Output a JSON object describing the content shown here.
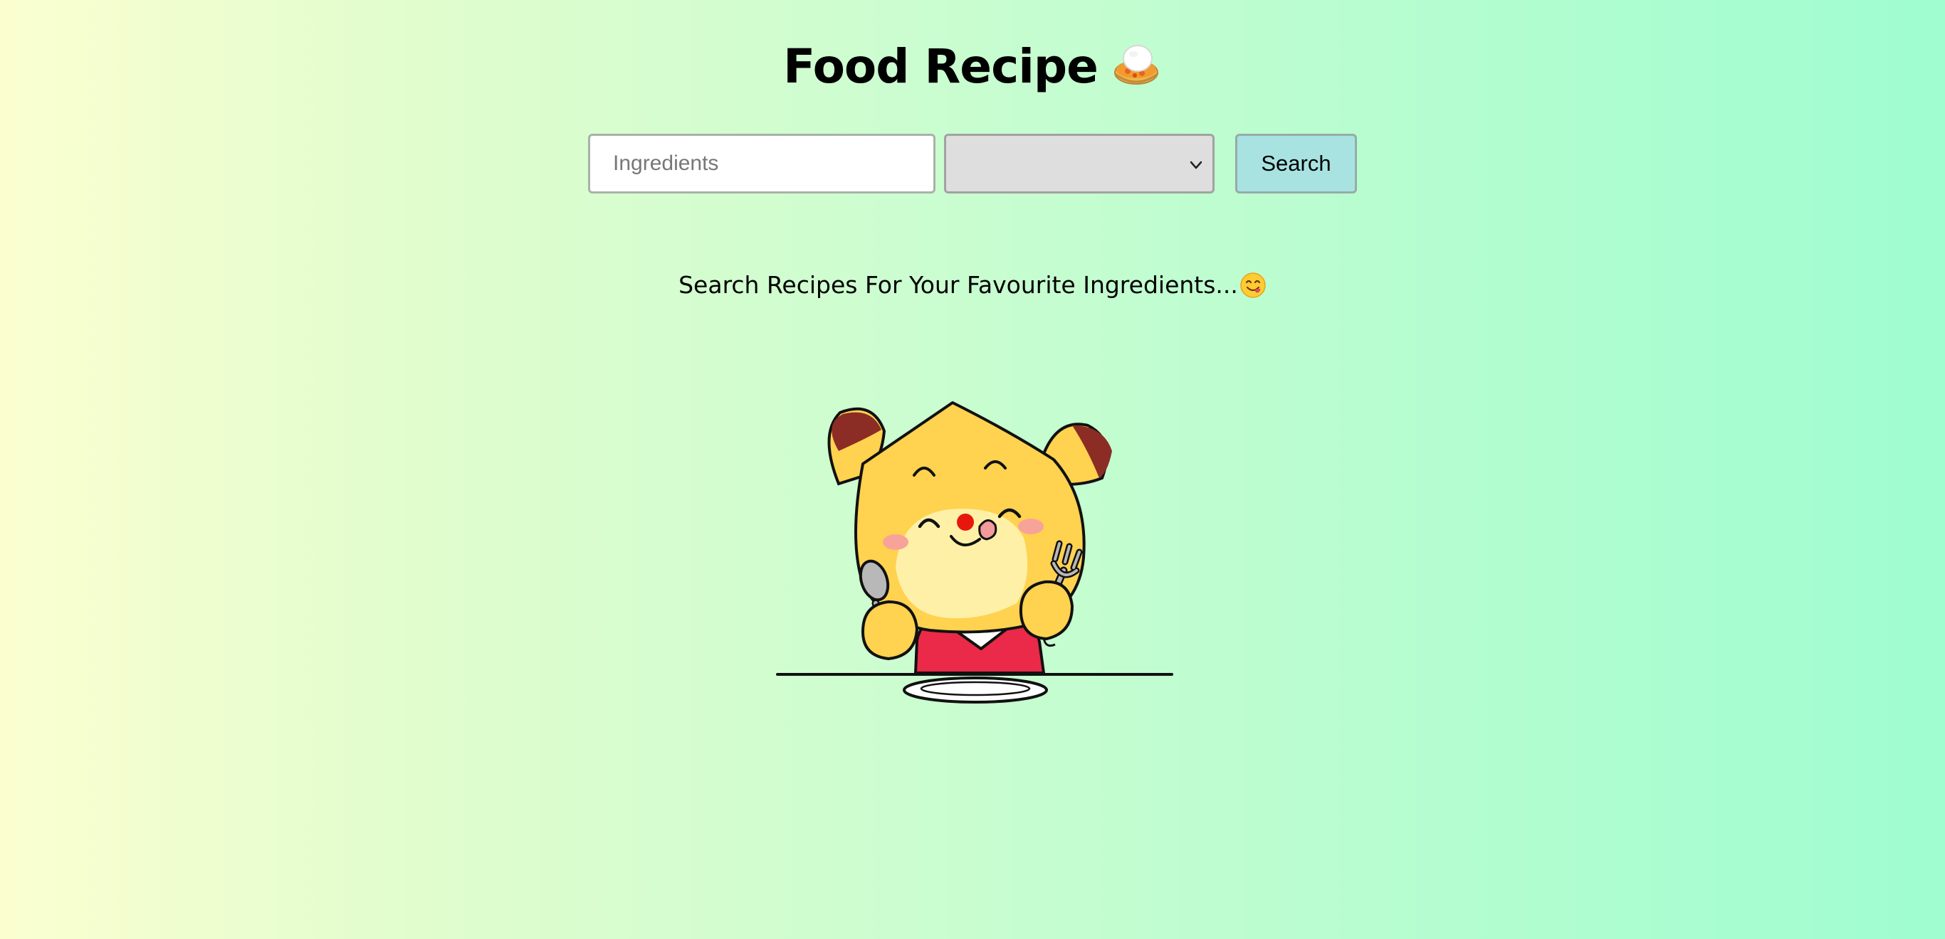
{
  "header": {
    "title": "Food Recipe",
    "title_icon": "rice-bowl-icon"
  },
  "search": {
    "ingredients_placeholder": "Ingredients",
    "ingredients_value": "",
    "category_selected": "",
    "button_label": "Search"
  },
  "main": {
    "prompt_text": "Search Recipes For Your Favourite Ingredients...",
    "prompt_icon": "yum-face-icon",
    "illustration": "cartoon-mascot-eating-icon"
  },
  "colors": {
    "background_start": "#fbffd0",
    "background_end": "#9ffdd0",
    "search_button": "#a8e3e2",
    "select_background": "#dedede"
  }
}
